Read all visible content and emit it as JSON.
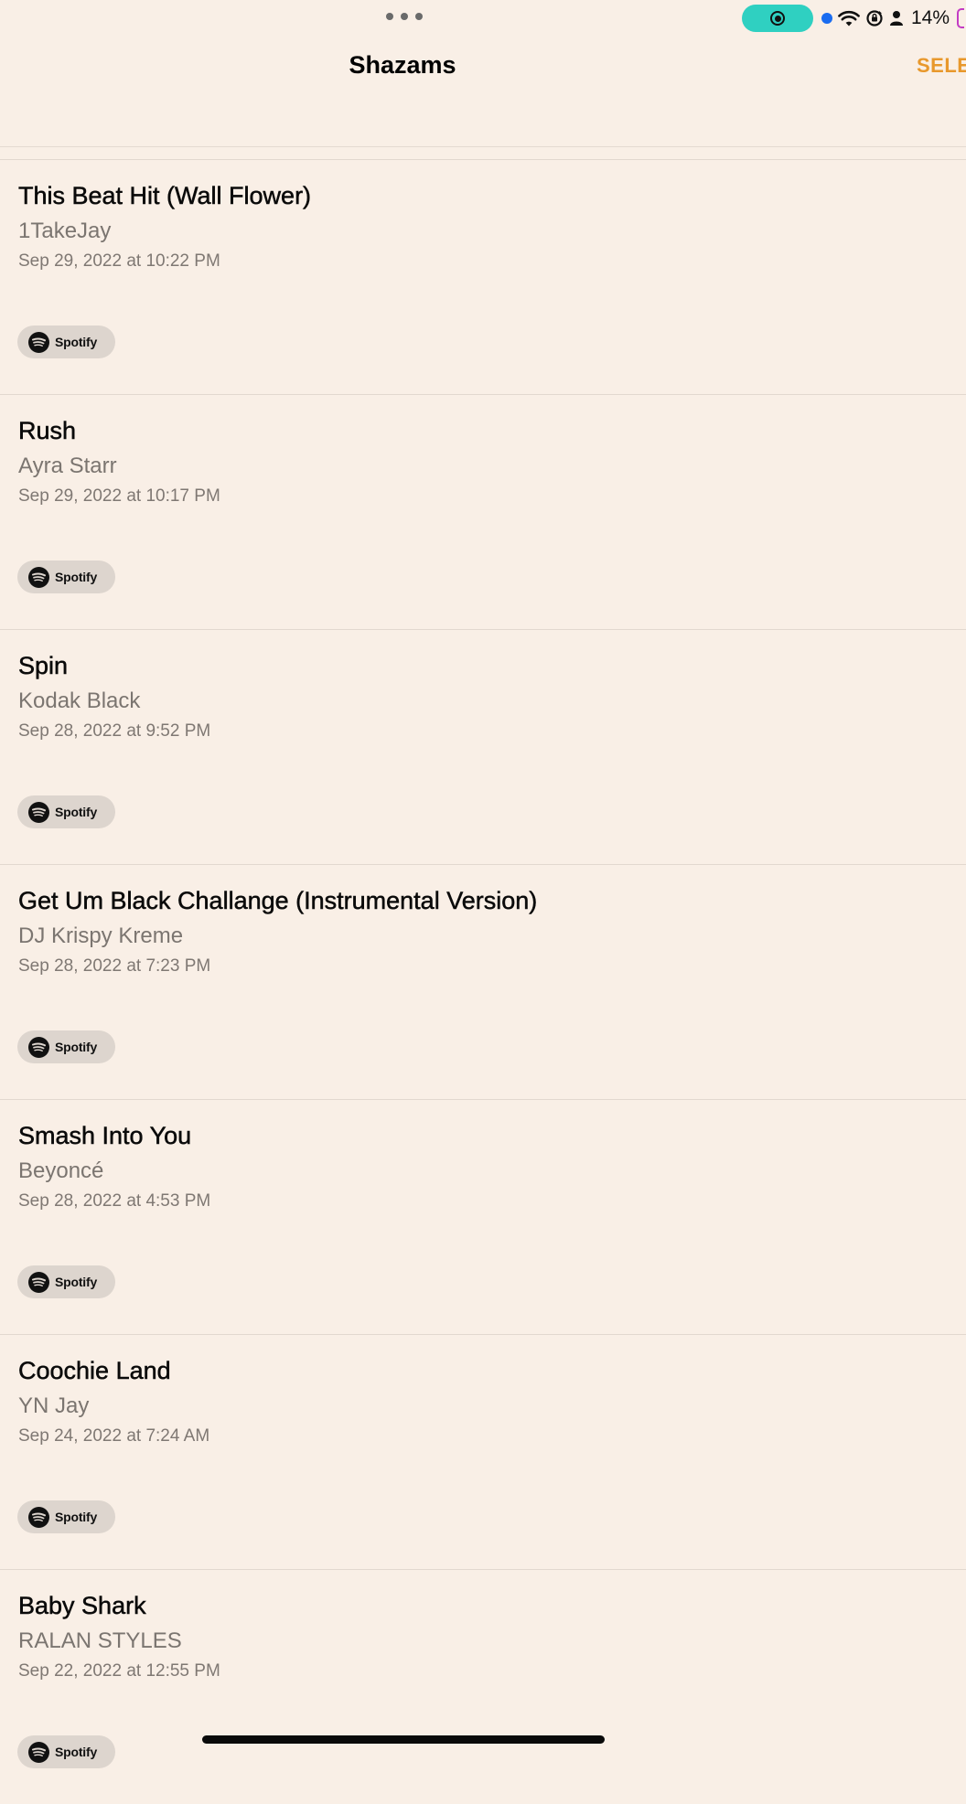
{
  "status_bar": {
    "battery_percent": "14%",
    "icons": [
      "multitask-dots-icon",
      "screen-record-icon",
      "location-dot-icon",
      "wifi-icon",
      "orientation-lock-icon",
      "person-icon",
      "battery-icon"
    ],
    "accent_colors": {
      "record_pill": "#2fd0c1",
      "location_dot": "#1a6cf0",
      "battery": "#c33cc4"
    }
  },
  "nav": {
    "title": "Shazams",
    "select_label": "SELE",
    "select_color": "#e8982c"
  },
  "shazams": [
    {
      "title": "This Beat Hit (Wall Flower)",
      "artist": "1TakeJay",
      "date": "Sep 29, 2022 at 10:22 PM",
      "service": "Spotify"
    },
    {
      "title": "Rush",
      "artist": "Ayra Starr",
      "date": "Sep 29, 2022 at 10:17 PM",
      "service": "Spotify"
    },
    {
      "title": "Spin",
      "artist": "Kodak Black",
      "date": "Sep 28, 2022 at 9:52 PM",
      "service": "Spotify"
    },
    {
      "title": "Get Um Black Challange (Instrumental Version)",
      "artist": "DJ Krispy Kreme",
      "date": "Sep 28, 2022 at 7:23 PM",
      "service": "Spotify"
    },
    {
      "title": "Smash Into You",
      "artist": "Beyoncé",
      "date": "Sep 28, 2022 at 4:53 PM",
      "service": "Spotify"
    },
    {
      "title": "Coochie Land",
      "artist": "YN Jay",
      "date": "Sep 24, 2022 at 7:24 AM",
      "service": "Spotify"
    },
    {
      "title": "Baby Shark",
      "artist": "RALAN STYLES",
      "date": "Sep 22, 2022 at 12:55 PM",
      "service": "Spotify"
    }
  ]
}
